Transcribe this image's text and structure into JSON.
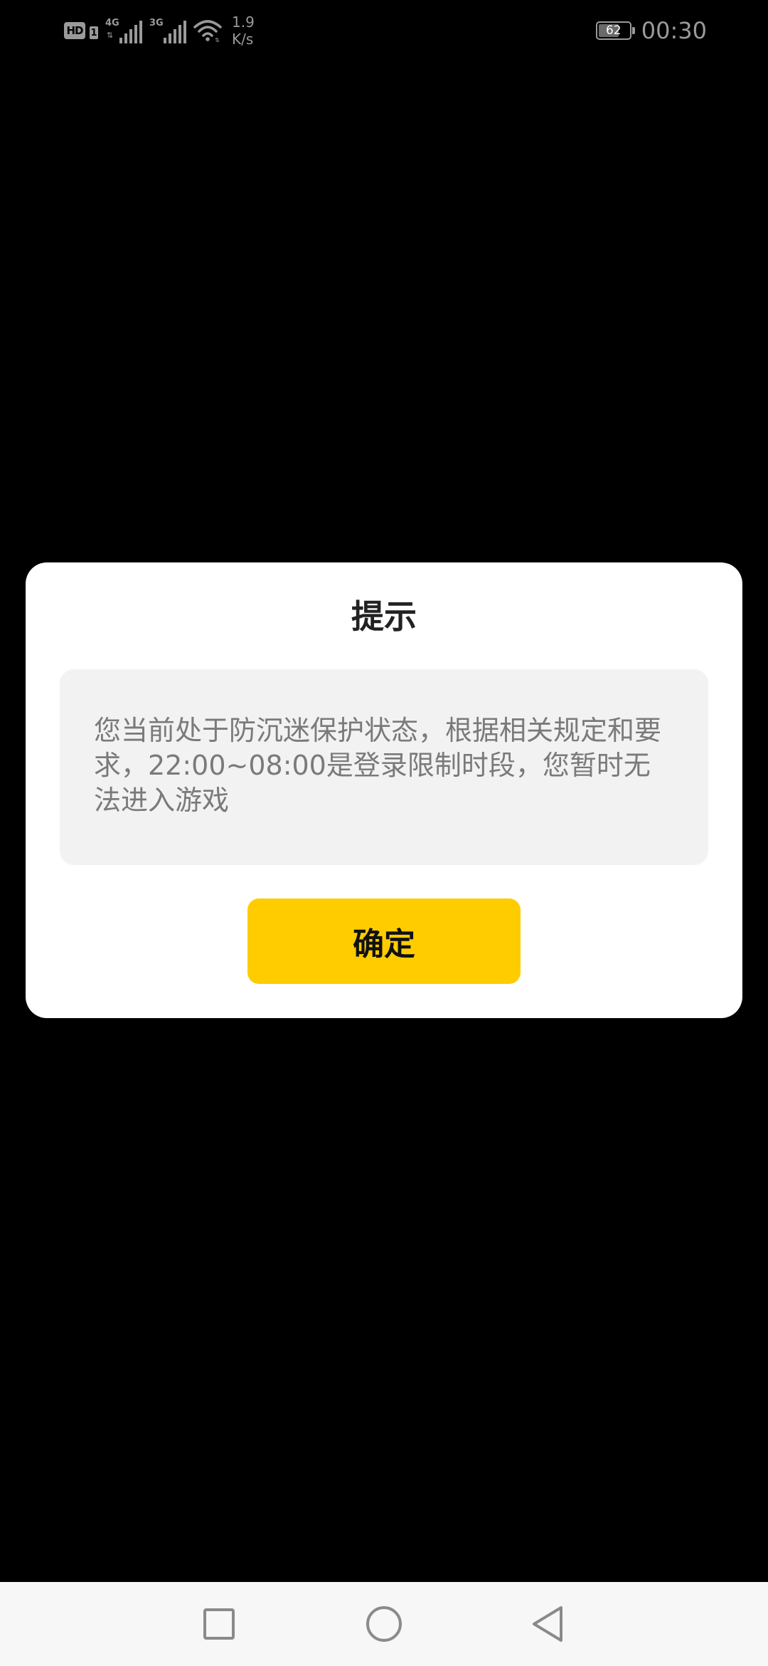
{
  "status_bar": {
    "hd_label": "HD",
    "sim_number": "1",
    "sim1_network": "4G",
    "sim2_network": "3G",
    "net_speed_value": "1.9",
    "net_speed_unit": "K/s",
    "battery_level": "62",
    "time": "00:30",
    "icons": [
      "hd-icon",
      "signal-icon",
      "wifi-icon",
      "battery-icon"
    ]
  },
  "dialog": {
    "title": "提示",
    "message": "您当前处于防沉迷保护状态，根据相关规定和要求，22:00~08:00是登录限制时段，您暂时无法进入游戏",
    "confirm_label": "确定"
  },
  "nav_bar": {
    "icons": [
      "recent-apps-icon",
      "home-icon",
      "back-icon"
    ]
  },
  "colors": {
    "background": "#000000",
    "dialog_bg": "#ffffff",
    "message_bg": "#f2f2f2",
    "accent": "#ffcc00",
    "status_text": "#9a9a9a"
  }
}
